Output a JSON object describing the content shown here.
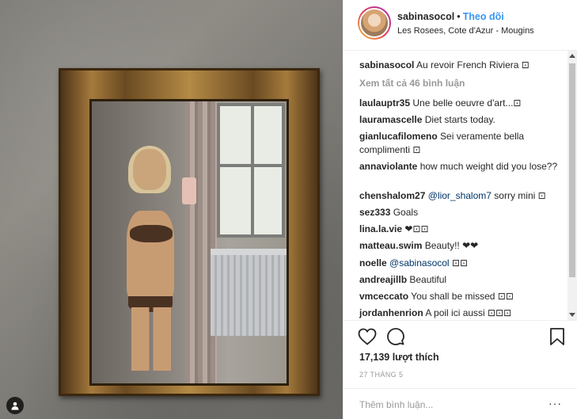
{
  "post": {
    "username": "sabinasocol",
    "separator": "•",
    "follow_label": "Theo dõi",
    "location": "Les Rosees, Cote d'Azur - Mougins"
  },
  "comments": [
    {
      "user": "sabinasocol",
      "text": "Au revoir French Riviera ⊡"
    },
    {
      "user": "laulauptr35",
      "text": "Une belle oeuvre d'art...⊡"
    },
    {
      "user": "lauramascelle",
      "text": "Diet starts today."
    },
    {
      "user": "gianlucafilomeno",
      "text": "Sei veramente bella complimenti ⊡"
    },
    {
      "user": "annaviolante",
      "text": "how much weight did you lose??"
    },
    {
      "user": "chenshalom27",
      "mention": "@lior_shalom7",
      "text": "sorry mini ⊡"
    },
    {
      "user": "sez333",
      "text": "Goals"
    },
    {
      "user": "lina.la.vie",
      "text": "❤⊡⊡"
    },
    {
      "user": "matteau.swim",
      "text": "Beauty!! ❤❤"
    },
    {
      "user": "noelle",
      "mention": "@sabinasocol",
      "text": "⊡⊡"
    },
    {
      "user": "andreajillb",
      "text": "Beautiful"
    },
    {
      "user": "vmceccato",
      "text": "You shall be missed ⊡⊡"
    },
    {
      "user": "jordanhenrion",
      "text": "A poil ici aussi ⊡⊡⊡"
    }
  ],
  "view_all_label": "Xem tất cả 46 bình luận",
  "likes_label": "17,139 lượt thích",
  "date_label": "27 THÁNG 5",
  "add_comment_placeholder": "Thêm bình luận...",
  "more_label": "···",
  "icons": {
    "like": "heart-icon",
    "comment": "comment-icon",
    "save": "bookmark-icon",
    "tag": "user-tag-icon"
  },
  "colors": {
    "follow": "#3897f0",
    "muted": "#999999",
    "text": "#262626"
  }
}
